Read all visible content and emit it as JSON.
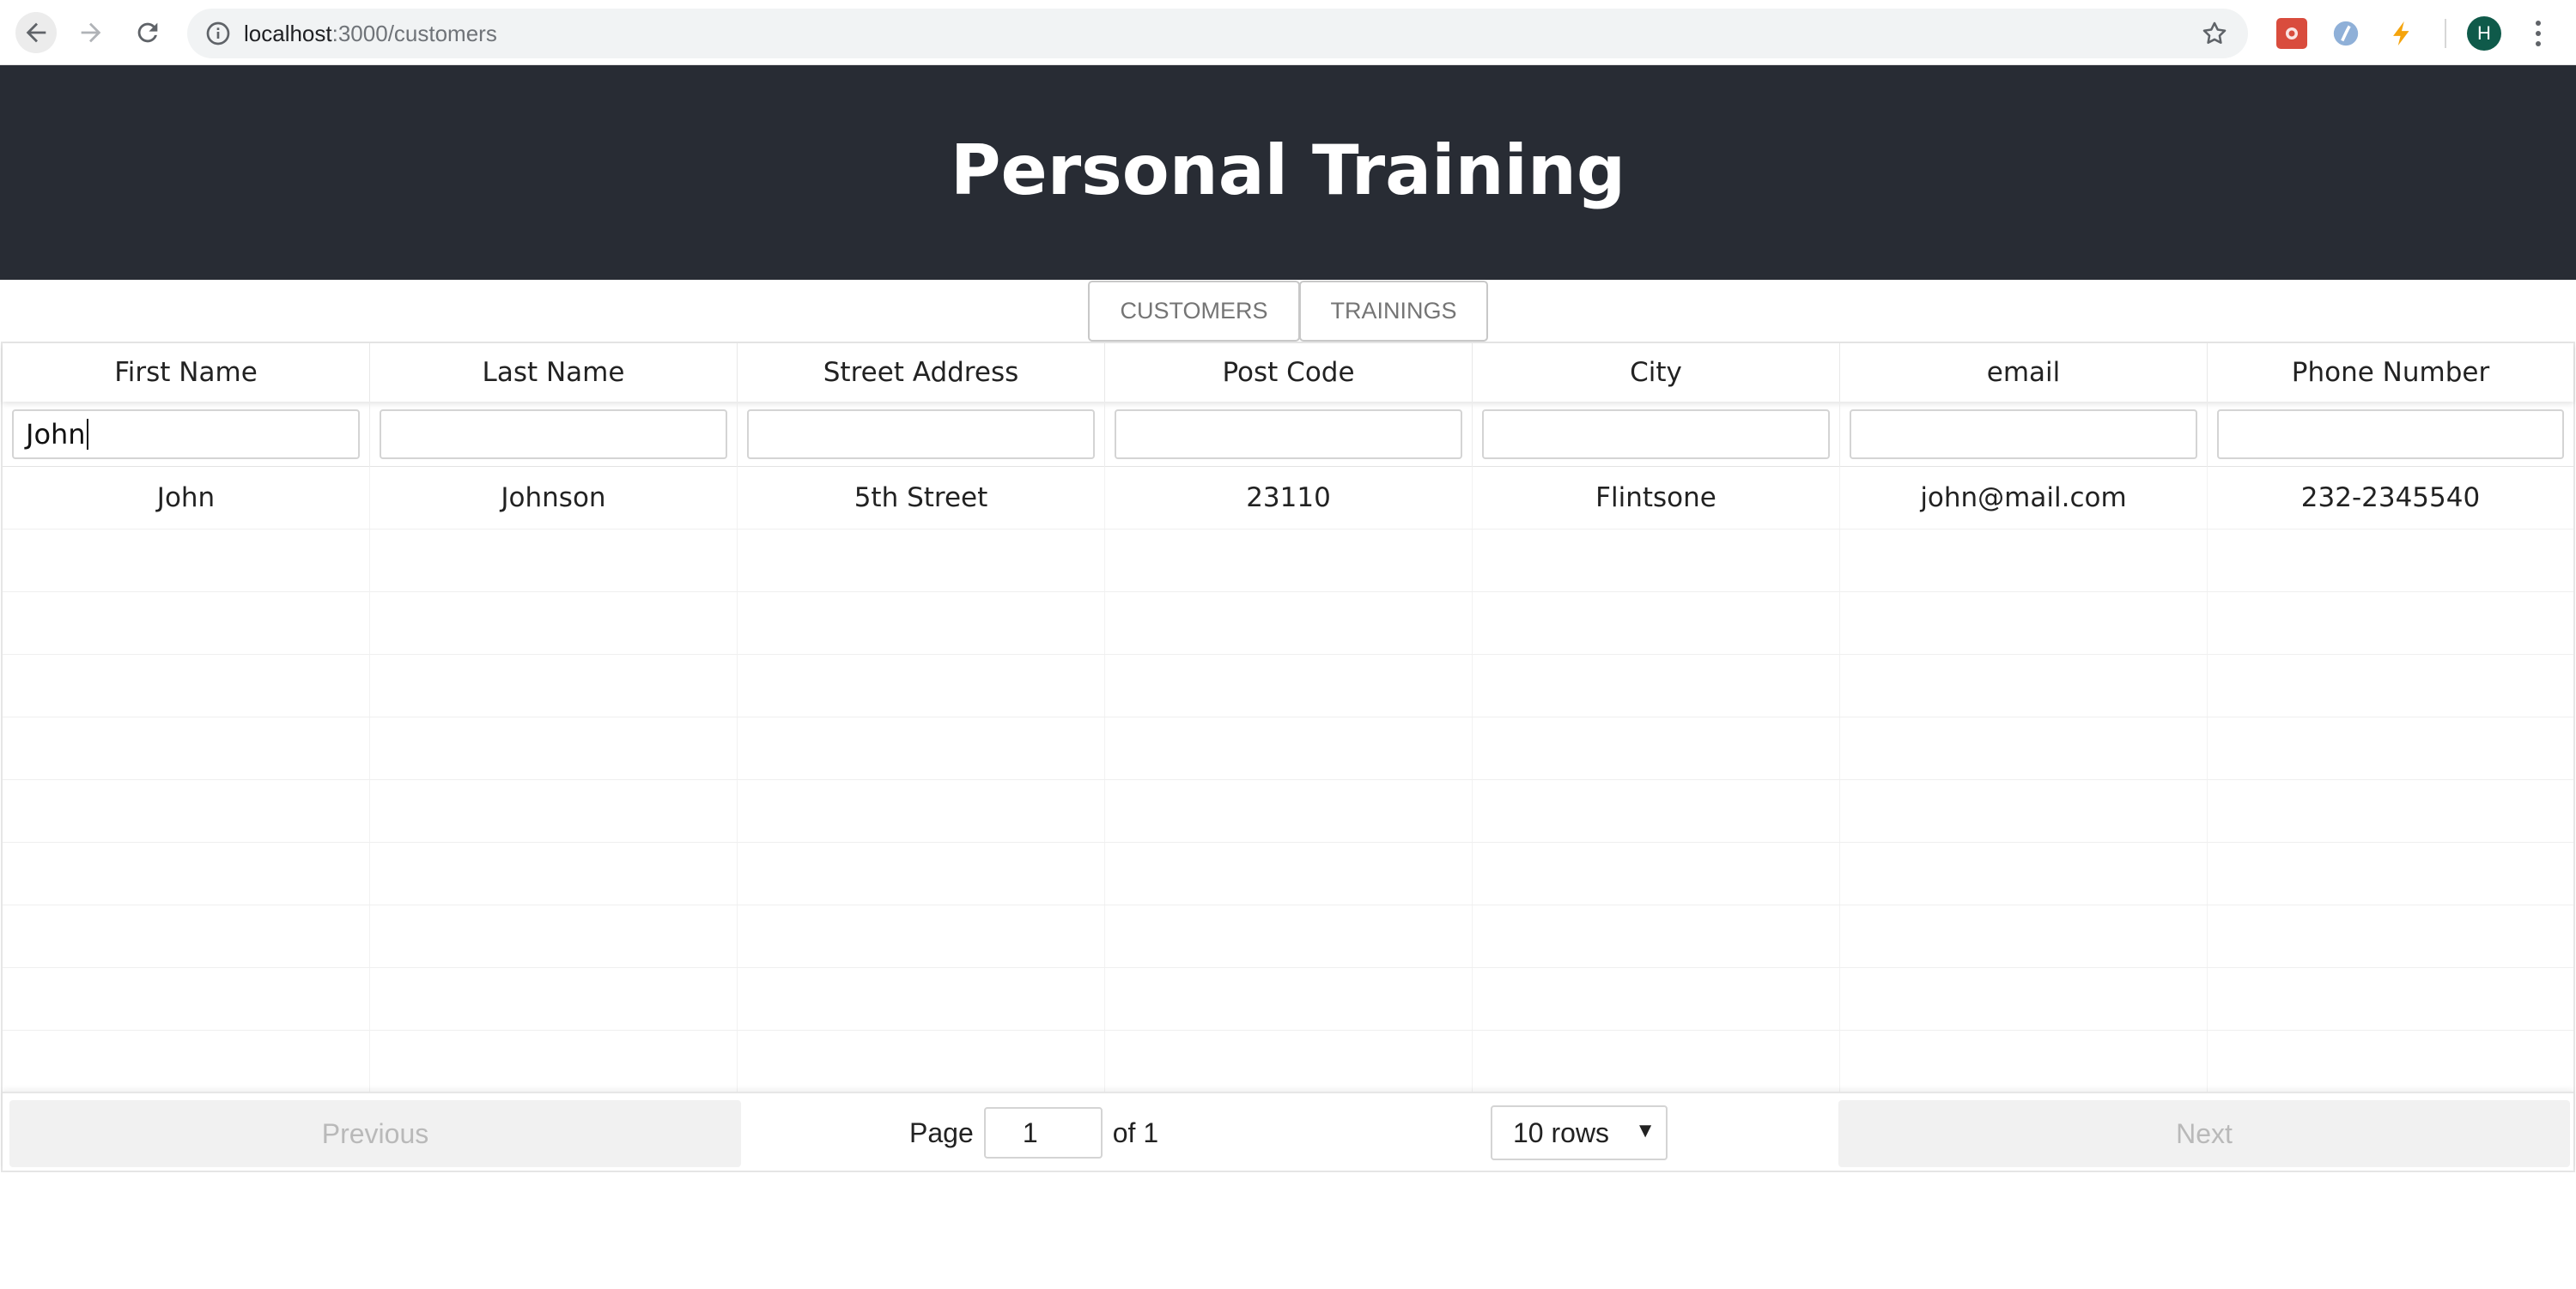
{
  "browser": {
    "url_host": "localhost",
    "url_path": ":3000/customers",
    "avatar_letter": "H"
  },
  "header": {
    "title": "Personal Training"
  },
  "tabs": [
    {
      "label": "CUSTOMERS"
    },
    {
      "label": "TRAININGS"
    }
  ],
  "table": {
    "columns": [
      "First Name",
      "Last Name",
      "Street Address",
      "Post Code",
      "City",
      "email",
      "Phone Number"
    ],
    "filters": [
      "John",
      "",
      "",
      "",
      "",
      "",
      ""
    ],
    "rows": [
      [
        "John",
        "Johnson",
        "5th Street",
        "23110",
        "Flintsone",
        "john@mail.com",
        "232-2345540"
      ]
    ],
    "empty_rows": 9
  },
  "pagination": {
    "previous_label": "Previous",
    "page_label": "Page",
    "current_page": "1",
    "of_label": "of 1",
    "rows_option": "10 rows",
    "next_label": "Next"
  }
}
